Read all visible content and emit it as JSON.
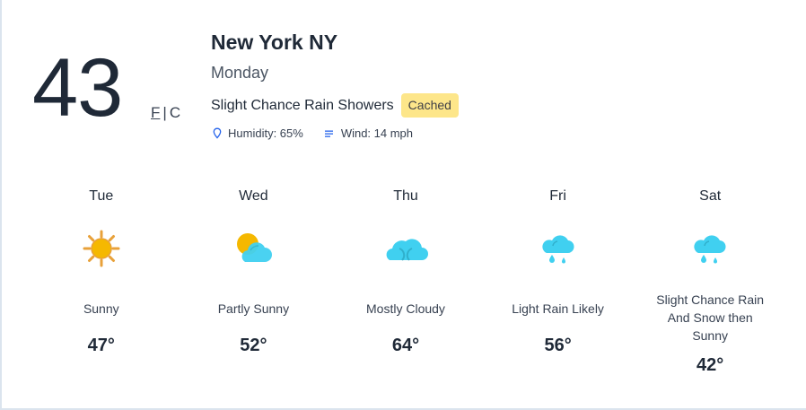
{
  "current": {
    "temperature": "43",
    "unit_f": "F",
    "unit_separator": "|",
    "unit_c": "C",
    "location": "New York NY",
    "day": "Monday",
    "condition": "Slight Chance Rain Showers",
    "badge": "Cached",
    "humidity": "Humidity: 65%",
    "wind": "Wind: 14 mph"
  },
  "forecast": [
    {
      "day": "Tue",
      "description": "Sunny",
      "temp": "47°",
      "icon": "sunny-icon"
    },
    {
      "day": "Wed",
      "description": "Partly Sunny",
      "temp": "52°",
      "icon": "partly-sunny-icon"
    },
    {
      "day": "Thu",
      "description": "Mostly Cloudy",
      "temp": "64°",
      "icon": "mostly-cloudy-icon"
    },
    {
      "day": "Fri",
      "description": "Light Rain Likely",
      "temp": "56°",
      "icon": "rain-icon"
    },
    {
      "day": "Sat",
      "description": "Slight Chance Rain And Snow then Sunny",
      "temp": "42°",
      "icon": "rain-icon"
    }
  ],
  "colors": {
    "sun": "#f5b800",
    "sun_outline": "#e8a13a",
    "cloud": "#40d0f0",
    "badge": "#fde68a",
    "accent_icon": "#2563eb"
  }
}
